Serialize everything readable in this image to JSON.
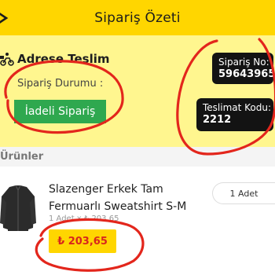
{
  "header": {
    "title": "Sipariş Özeti"
  },
  "order": {
    "delivery_title": "Adrese Teslim",
    "status_label": "Sipariş Durumu :",
    "status_value": "İadeli Sipariş",
    "order_no_label": "Sipariş No:",
    "order_no_value": "59643965",
    "delivery_code_label": "Teslimat Kodu:",
    "delivery_code_value": "2212"
  },
  "products_section": {
    "label": "Ürünler"
  },
  "product": {
    "name": "Slazenger Erkek Tam Fermuarlı Sweatshirt S-M",
    "unit_price_line": "1 Adet x ₺ 203,65",
    "price": "₺ 203,65",
    "quantity": "1 Adet"
  },
  "colors": {
    "header_bg": "#ffd600",
    "panel_bg": "#fff68f",
    "status_badge": "#2fa84f",
    "info_box": "#131313",
    "price_text": "#d8261d",
    "annotation": "#e3261c"
  },
  "icons": [
    "close-icon",
    "courier-icon",
    "sweatshirt-image"
  ]
}
